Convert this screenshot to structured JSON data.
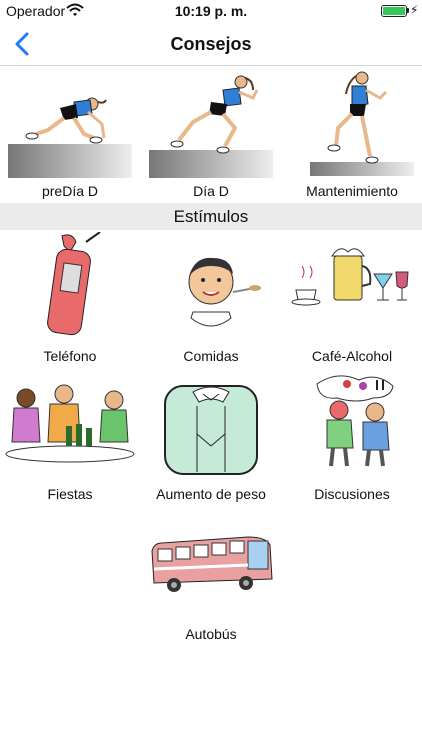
{
  "status_bar": {
    "carrier": "Operador",
    "time": "10:19 p. m.",
    "battery_level": 1.0,
    "icons": [
      "wifi-icon",
      "battery-icon",
      "charging-bolt-icon"
    ]
  },
  "nav": {
    "title": "Consejos",
    "back_icon": "chevron-left-icon",
    "accent_color": "#1a7cf5"
  },
  "phases": [
    {
      "label": "preDía D",
      "icon": "runner-crouch-start-icon"
    },
    {
      "label": "Día D",
      "icon": "runner-sprint-icon"
    },
    {
      "label": "Mantenimiento",
      "icon": "runner-jog-icon"
    }
  ],
  "stimuli_section": {
    "title": "Estímulos",
    "items": [
      {
        "label": "Teléfono",
        "icon": "telephone-icon"
      },
      {
        "label": "Comidas",
        "icon": "person-eating-icon"
      },
      {
        "label": "Café-Alcohol",
        "icon": "coffee-beer-drinks-icon"
      },
      {
        "label": "Fiestas",
        "icon": "party-people-icon"
      },
      {
        "label": "Aumento de peso",
        "icon": "bathroom-scale-icon"
      },
      {
        "label": "Discusiones",
        "icon": "arguing-people-icon"
      },
      {
        "label": "Autobús",
        "icon": "bus-icon"
      }
    ]
  }
}
